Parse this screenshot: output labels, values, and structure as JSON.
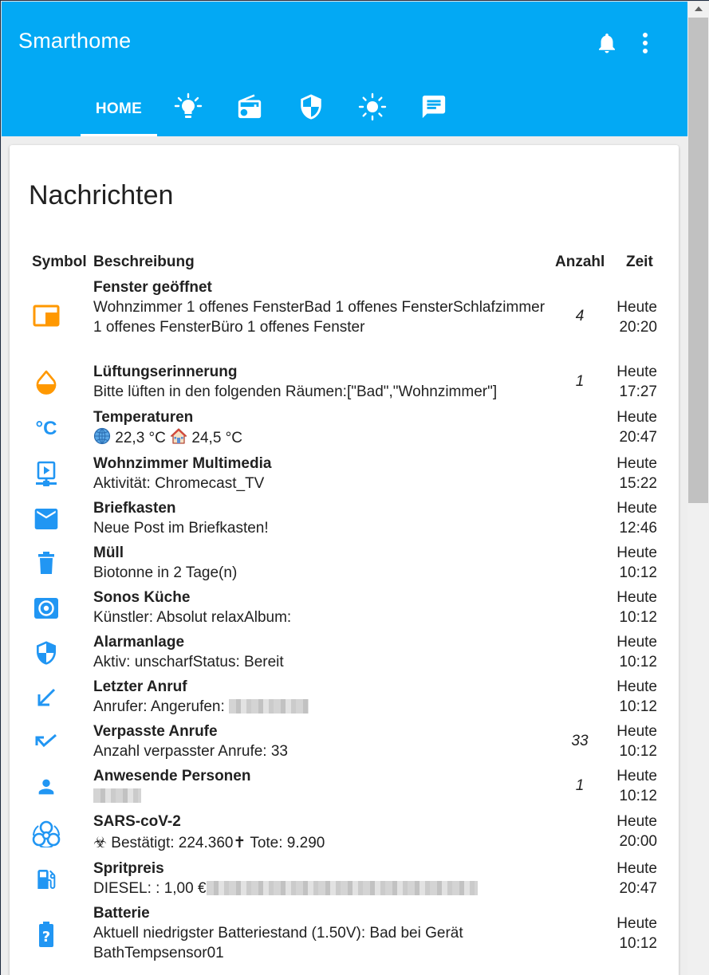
{
  "app": {
    "title": "Smarthome"
  },
  "tabs": [
    {
      "label": "HOME",
      "active": true
    },
    {
      "icon": "lightbulb-icon"
    },
    {
      "icon": "radio-icon"
    },
    {
      "icon": "shield-icon"
    },
    {
      "icon": "sun-icon"
    },
    {
      "icon": "message-icon"
    }
  ],
  "colors": {
    "primary": "#03a9f4",
    "accent_icon": "#2196f3",
    "warning_icon": "#ff9800"
  },
  "card": {
    "title": "Nachrichten"
  },
  "table": {
    "headers": {
      "symbol": "Symbol",
      "description": "Beschreibung",
      "count": "Anzahl",
      "time": "Zeit"
    },
    "rows": [
      {
        "icon": "window-open-icon",
        "title": "Fenster geöffnet",
        "description": "Wohnzimmer 1 offenes FensterBad 1 offenes FensterSchlafzimmer 1 offenes FensterBüro 1 offenes Fenster",
        "count": "4",
        "time_day": "Heute",
        "time_clock": "20:20"
      },
      {
        "icon": "water-drop-icon",
        "title": "Lüftungserinnerung",
        "description": "Bitte lüften in den folgenden Räumen:[\"Bad\",\"Wohnzimmer\"]",
        "count": "1",
        "time_day": "Heute",
        "time_clock": "17:27"
      },
      {
        "icon": "celsius-icon",
        "title": "Temperaturen",
        "temp_outside": "22,3 °C",
        "temp_inside": "24,5 °C",
        "count": "",
        "time_day": "Heute",
        "time_clock": "20:47"
      },
      {
        "icon": "multimedia-icon",
        "title": "Wohnzimmer Multimedia",
        "description": "Aktivität: Chromecast_TV",
        "count": "",
        "time_day": "Heute",
        "time_clock": "15:22"
      },
      {
        "icon": "mail-icon",
        "title": "Briefkasten",
        "description": "Neue Post im Briefkasten!",
        "count": "",
        "time_day": "Heute",
        "time_clock": "12:46"
      },
      {
        "icon": "trash-icon",
        "title": "Müll",
        "description": "Biotonne in 2 Tage(n)",
        "count": "",
        "time_day": "Heute",
        "time_clock": "10:12"
      },
      {
        "icon": "speaker-icon",
        "title": "Sonos Küche",
        "description": "Künstler: Absolut relaxAlbum:",
        "count": "",
        "time_day": "Heute",
        "time_clock": "10:12"
      },
      {
        "icon": "shield-icon",
        "title": "Alarmanlage",
        "description": "Aktiv: unscharfStatus: Bereit",
        "count": "",
        "time_day": "Heute",
        "time_clock": "10:12"
      },
      {
        "icon": "call-received-icon",
        "title": "Letzter Anruf",
        "description": "Anrufer: Angerufen: ",
        "count": "",
        "time_day": "Heute",
        "time_clock": "10:12"
      },
      {
        "icon": "call-missed-icon",
        "title": "Verpasste Anrufe",
        "description": "Anzahl verpasster Anrufe: 33",
        "count": "33",
        "time_day": "Heute",
        "time_clock": "10:12"
      },
      {
        "icon": "person-icon",
        "title": "Anwesende Personen",
        "description": "",
        "count": "1",
        "time_day": "Heute",
        "time_clock": "10:12"
      },
      {
        "icon": "biohazard-icon",
        "title": "SARS-coV-2",
        "description": "☣ Bestätigt: 224.360✝ Tote: 9.290",
        "count": "",
        "time_day": "Heute",
        "time_clock": "20:00"
      },
      {
        "icon": "fuel-icon",
        "title": "Spritpreis",
        "description": "DIESEL: : 1,00 €",
        "count": "",
        "time_day": "Heute",
        "time_clock": "20:47"
      },
      {
        "icon": "battery-unknown-icon",
        "title": "Batterie",
        "description": "Aktuell niedrigster Batteriestand (1.50V): Bad bei Gerät BathTempsensor01",
        "count": "",
        "time_day": "Heute",
        "time_clock": "10:12"
      }
    ]
  }
}
